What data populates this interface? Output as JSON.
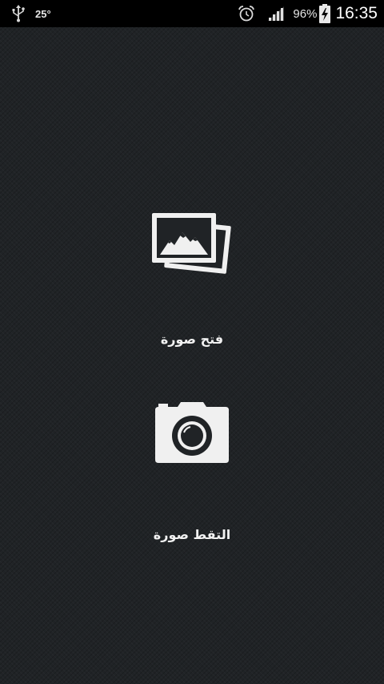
{
  "status_bar": {
    "temperature": "25°",
    "battery_percent": "96%",
    "time": "16:35",
    "icons": [
      "usb-icon",
      "alarm-icon",
      "signal-icon",
      "battery-charging-icon"
    ]
  },
  "actions": {
    "open_photo": {
      "label": "فتح صورة",
      "icon": "gallery-icon"
    },
    "take_photo": {
      "label": "التقط صورة",
      "icon": "camera-icon"
    }
  },
  "colors": {
    "background": "#202326",
    "status_bar": "#000000",
    "icon_fill": "#f0f0f0",
    "text": "#f2f2f2"
  }
}
